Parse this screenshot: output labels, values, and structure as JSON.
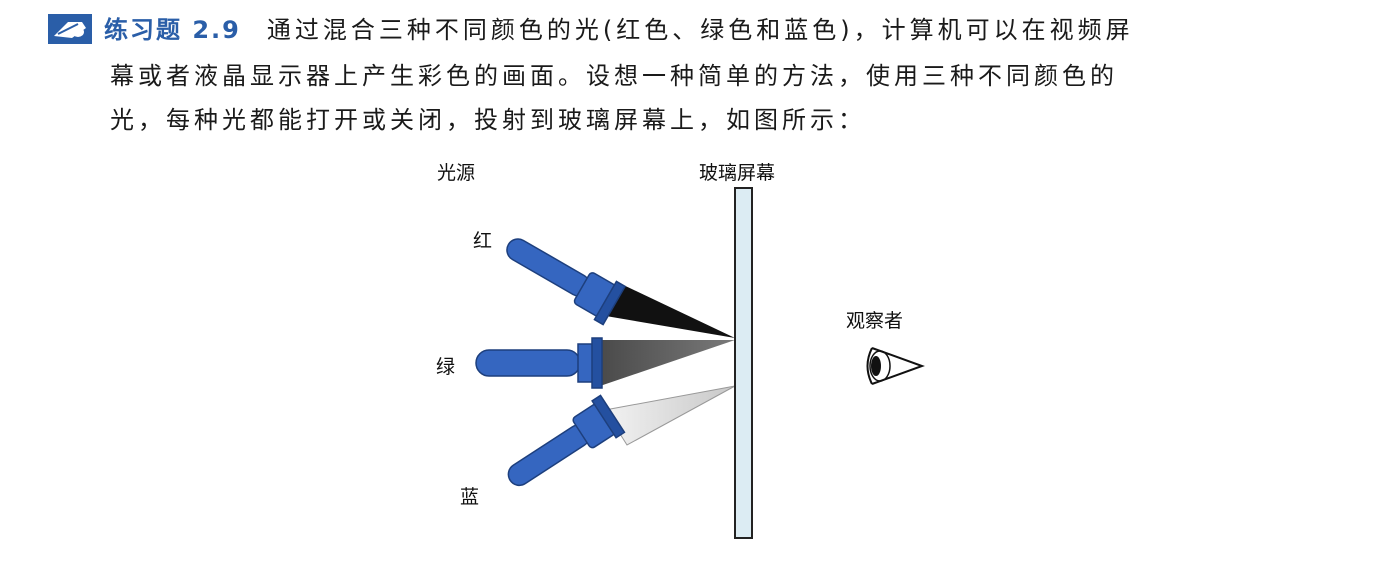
{
  "exercise": {
    "icon": "pencil-hand-icon",
    "label": "练习题 2.9",
    "line1": "通过混合三种不同颜色的光(红色、绿色和蓝色)，计算机可以在视频屏",
    "line2": "幕或者液晶显示器上产生彩色的画面。设想一种简单的方法，使用三种不同颜色的",
    "line3": "光，每种光都能打开或关闭，投射到玻璃屏幕上，如图所示："
  },
  "figure": {
    "light_source_label": "光源",
    "screen_label": "玻璃屏幕",
    "red_label": "红",
    "green_label": "绿",
    "blue_label": "蓝",
    "observer_label": "观察者"
  },
  "colors": {
    "label_blue": "#2a5ea8",
    "flashlight_blue": "#3566c0",
    "screen_fill": "#dcecf3"
  }
}
